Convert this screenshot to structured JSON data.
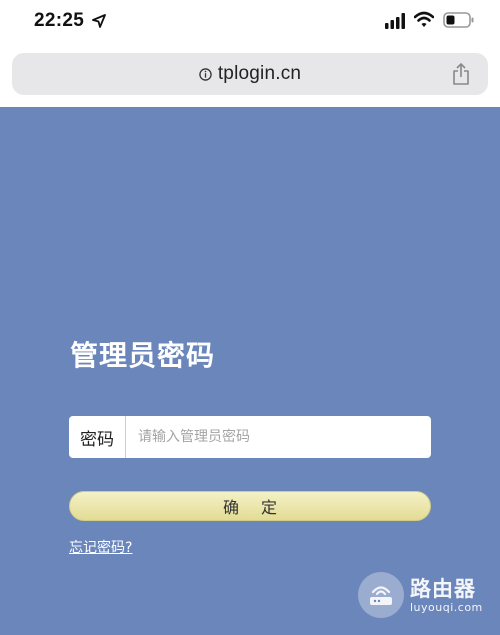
{
  "status_bar": {
    "time": "22:25",
    "icons": [
      "location-arrow-icon",
      "cellular-signal-icon",
      "wifi-icon",
      "battery-icon"
    ]
  },
  "browser": {
    "url": "tplogin.cn",
    "icons": [
      "info-icon",
      "share-icon"
    ]
  },
  "login": {
    "title": "管理员密码",
    "password_label": "密码",
    "password_placeholder": "请输入管理员密码",
    "password_value": "",
    "confirm_label": "确定",
    "forgot_link": "忘记密码?"
  },
  "watermark": {
    "title": "路由器",
    "url": "luyouqi.com",
    "icon": "router-logo-icon"
  },
  "colors": {
    "background": "#6a86bb",
    "button_gradient_top": "#f4f1c6",
    "button_gradient_bottom": "#e3dc95",
    "url_bar": "#e7e7ea"
  }
}
